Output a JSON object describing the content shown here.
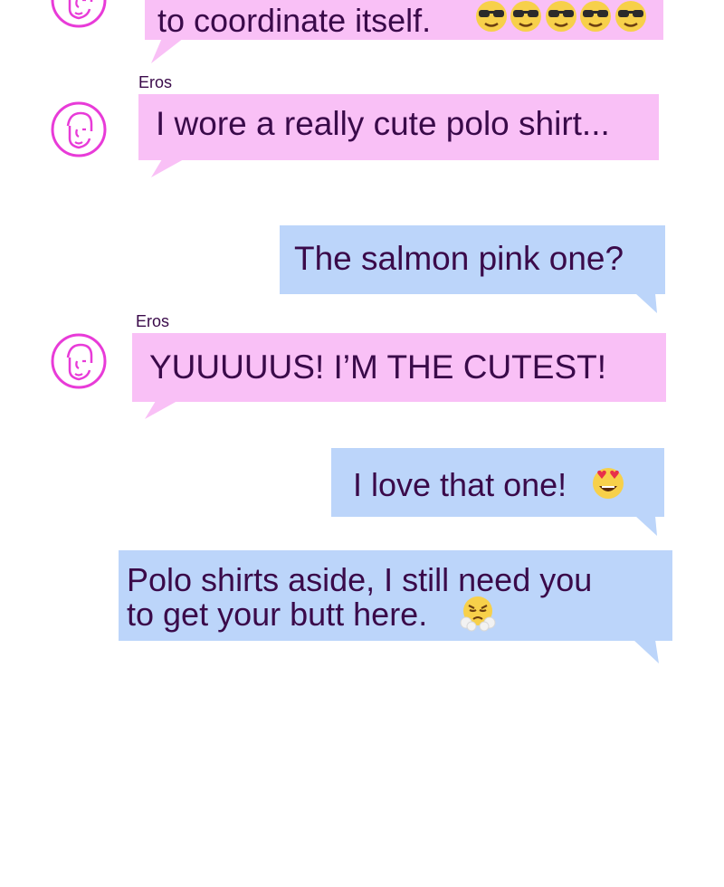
{
  "messages": [
    {
      "sender": "",
      "text": "to coordinate itself.",
      "emoji": [
        "sunglasses-emoji",
        "sunglasses-emoji",
        "sunglasses-emoji",
        "sunglasses-emoji",
        "sunglasses-emoji"
      ]
    },
    {
      "sender": "Eros",
      "text": "I wore a really cute polo shirt..."
    },
    {
      "sender": "",
      "text": "The salmon pink one?"
    },
    {
      "sender": "Eros",
      "text": "YUUUUUS! I’M THE CUTEST!"
    },
    {
      "sender": "",
      "text": "I love that one!",
      "emoji": [
        "heart-eyes-emoji"
      ]
    },
    {
      "sender": "",
      "text_line1": "Polo shirts aside, I still need you",
      "text_line2": "to get your butt here.",
      "emoji": [
        "steam-from-nose-emoji"
      ]
    }
  ],
  "colors": {
    "incoming": "#f9c0f6",
    "outgoing": "#bcd5fa",
    "avatar": "#e83bd8",
    "text": "#3a0a4a"
  }
}
